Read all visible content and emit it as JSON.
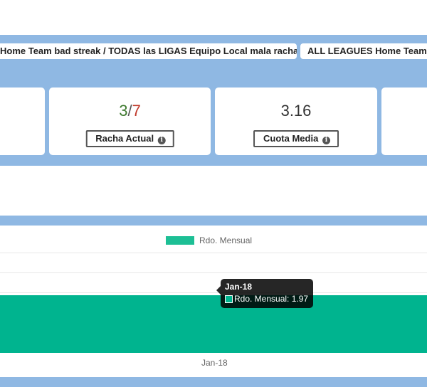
{
  "tabs": [
    {
      "label": "Home Team bad streak / TODAS las LIGAS Equipo Local mala racha"
    },
    {
      "label": "ALL LEAGUES Home Team"
    }
  ],
  "cards": [
    {
      "value": "",
      "label": ""
    },
    {
      "streak_won": "3",
      "streak_sep": "/",
      "streak_lost": "7",
      "label": "Racha Actual"
    },
    {
      "value": "3.16",
      "label": "Cuota Media"
    },
    {
      "value": "",
      "label": ""
    }
  ],
  "info_icon": "info-icon",
  "colors": {
    "band": "#8fb8e3",
    "bar": "#00b48f",
    "legend": "#1dbf95",
    "streak_won": "#3e7a2f",
    "streak_lost": "#c0392b"
  },
  "chart_data": {
    "type": "bar",
    "categories": [
      "Jan-18"
    ],
    "series": [
      {
        "name": "Rdo. Mensual",
        "values": [
          1.97
        ]
      }
    ],
    "legend": "top-center",
    "grid": true,
    "tooltip": {
      "title": "Jan-18",
      "series": "Rdo. Mensual",
      "value": "1.97"
    }
  }
}
